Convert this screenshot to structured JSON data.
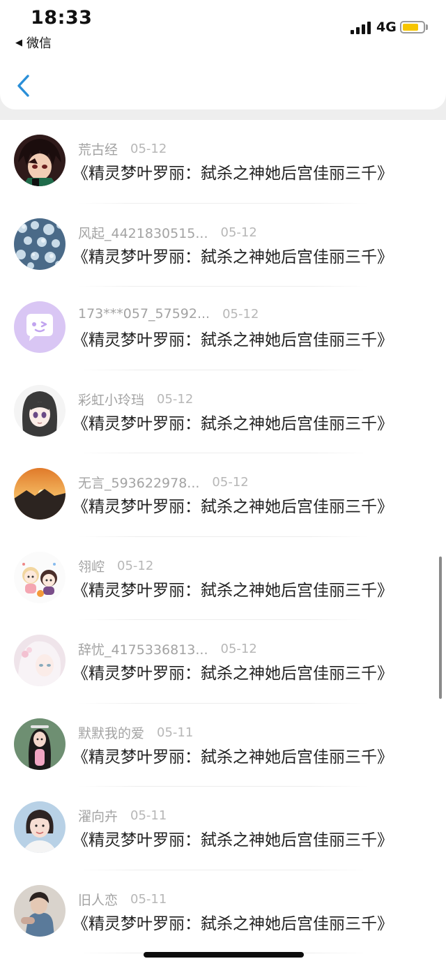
{
  "status_bar": {
    "time": "18:33",
    "back_app": "微信",
    "network": "4G",
    "battery_color": "#f6c500"
  },
  "nav": {
    "back_icon": "chevron-left-icon",
    "accent_color": "#2a8fd8"
  },
  "comments": [
    {
      "user": "荒古经",
      "date": "05-12",
      "text": "《精灵梦叶罗丽：弑杀之神她后宫佳丽三千》",
      "avatar": "anime-boy-avatar"
    },
    {
      "user": "风起_4421830515...",
      "date": "05-12",
      "text": "《精灵梦叶罗丽：弑杀之神她后宫佳丽三千》",
      "avatar": "snowy-branches-avatar"
    },
    {
      "user": "173***057_57592...",
      "date": "05-12",
      "text": "《精灵梦叶罗丽：弑杀之神她后宫佳丽三千》",
      "avatar": "chat-bubble-avatar"
    },
    {
      "user": "彩虹小玲珰",
      "date": "05-12",
      "text": "《精灵梦叶罗丽：弑杀之神她后宫佳丽三千》",
      "avatar": "anime-girl-avatar"
    },
    {
      "user": "无言_593622978...",
      "date": "05-12",
      "text": "《精灵梦叶罗丽：弑杀之神她后宫佳丽三千》",
      "avatar": "sunset-avatar"
    },
    {
      "user": "翎崆",
      "date": "05-12",
      "text": "《精灵梦叶罗丽：弑杀之神她后宫佳丽三千》",
      "avatar": "chibi-avatar"
    },
    {
      "user": "辞忧_4175336813...",
      "date": "05-12",
      "text": "《精灵梦叶罗丽：弑杀之神她后宫佳丽三千》",
      "avatar": "white-hair-avatar"
    },
    {
      "user": "默默我的爱",
      "date": "05-11",
      "text": "《精灵梦叶罗丽：弑杀之神她后宫佳丽三千》",
      "avatar": "doll-avatar"
    },
    {
      "user": "濯向卉",
      "date": "05-11",
      "text": "《精灵梦叶罗丽：弑杀之神她后宫佳丽三千》",
      "avatar": "girl-photo-avatar"
    },
    {
      "user": "旧人恋",
      "date": "05-11",
      "text": "《精灵梦叶罗丽：弑杀之神她后宫佳丽三千》",
      "avatar": "portrait-avatar"
    }
  ]
}
